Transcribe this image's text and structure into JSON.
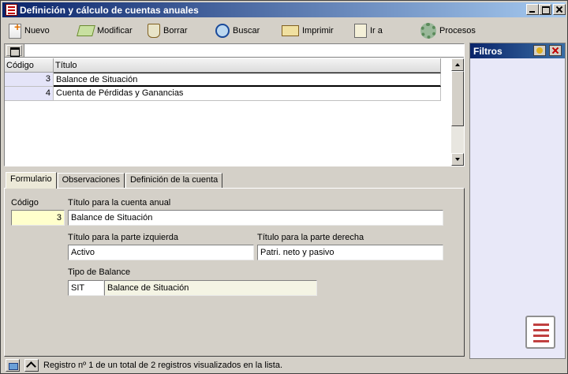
{
  "window": {
    "title": "Definición y cálculo de cuentas anuales"
  },
  "toolbar": {
    "new_label": "Nuevo",
    "edit_label": "Modificar",
    "delete_label": "Borrar",
    "search_label": "Buscar",
    "print_label": "Imprimir",
    "goto_label": "Ir a",
    "processes_label": "Procesos"
  },
  "grid": {
    "columns": [
      "Código",
      "Título"
    ],
    "rows": [
      {
        "code": "3",
        "title": "Balance de Situación"
      },
      {
        "code": "4",
        "title": "Cuenta de Pérdidas y Ganancias"
      }
    ]
  },
  "tabs": [
    "Formulario",
    "Observaciones",
    "Definición de la cuenta"
  ],
  "form": {
    "code_label": "Código",
    "code_value": "3",
    "title_label": "Título para la cuenta anual",
    "title_value": "Balance de Situación",
    "left_label": "Título para la parte izquierda",
    "left_value": "Activo",
    "right_label": "Título para la parte derecha",
    "right_value": "Patri. neto y pasivo",
    "balance_type_label": "Tipo de Balance",
    "balance_type_code": "SIT",
    "balance_type_desc": "Balance de Situación"
  },
  "filters": {
    "title": "Filtros"
  },
  "status": {
    "text": "Registro nº 1 de un total de 2 registros visualizados en la lista."
  },
  "icons": [
    "app-icon",
    "new-icon",
    "edit-icon",
    "delete-icon",
    "search-icon",
    "print-icon",
    "goto-icon",
    "gear-icon",
    "grid-icon",
    "notebook-icon",
    "folder-icon",
    "chevron-up-icon"
  ]
}
